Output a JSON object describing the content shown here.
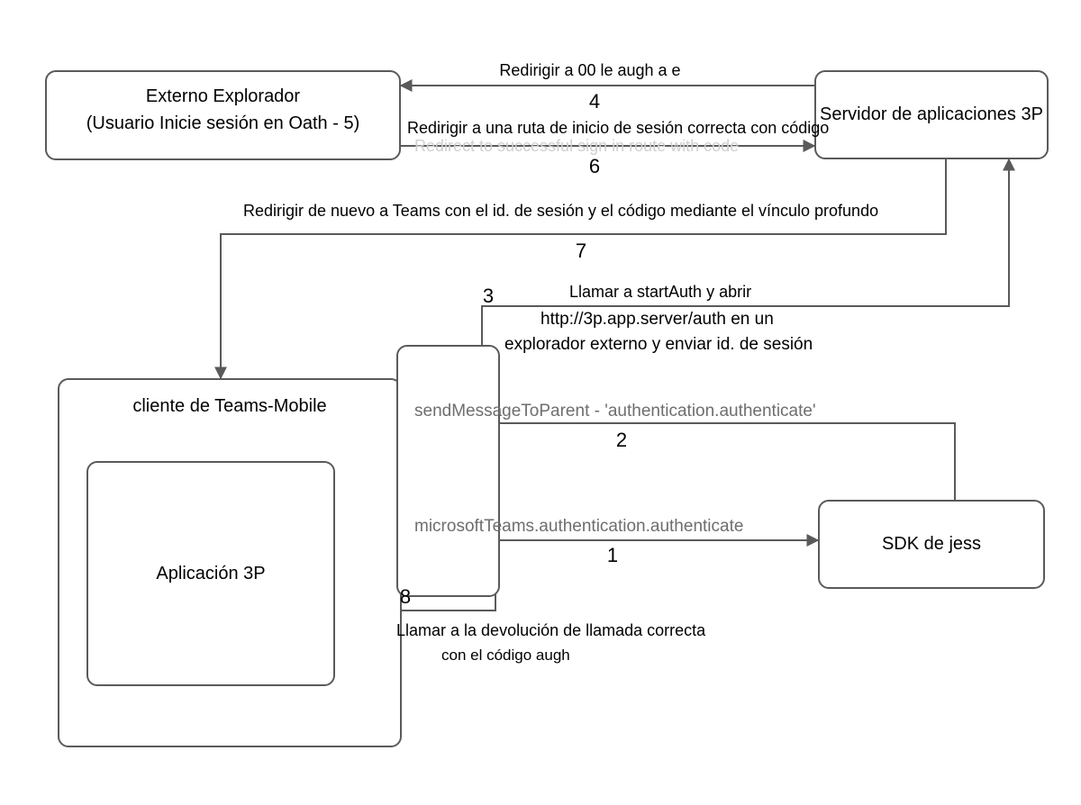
{
  "nodes": {
    "external_browser": {
      "line1": "Externo    Explorador",
      "line2": "(Usuario Inicie sesión en Oath - 5)"
    },
    "server_3p": "Servidor de aplicaciones 3P",
    "teams_mobile": "cliente de Teams-Mobile",
    "app_3p": "Aplicación 3P",
    "sdk": "SDK de jess"
  },
  "edges": {
    "e1": {
      "num": "1",
      "label": "microsoftTeams.authentication.authenticate"
    },
    "e2": {
      "num": "2",
      "label": "sendMessageToParent - 'authentication.authenticate'"
    },
    "e3": {
      "num": "3",
      "label_a": "Llamar a startAuth y abrir",
      "label_b": "http://3p.app.server/auth en un",
      "label_c": "explorador externo y enviar id. de sesión"
    },
    "e4": {
      "num": "4",
      "label": "Redirigir a 00 le augh a e"
    },
    "e6": {
      "num": "6",
      "label": "Redirigir a una ruta de inicio de sesión correcta con código",
      "ghost": "Redirect to successful sign in route with code"
    },
    "e7": {
      "num": "7",
      "label": "Redirigir de nuevo a Teams con el id. de sesión y el código mediante el vínculo profundo"
    },
    "e8": {
      "num": "8",
      "label_a": "Llamar a la devolución de llamada correcta",
      "label_b": "con el código augh"
    }
  }
}
